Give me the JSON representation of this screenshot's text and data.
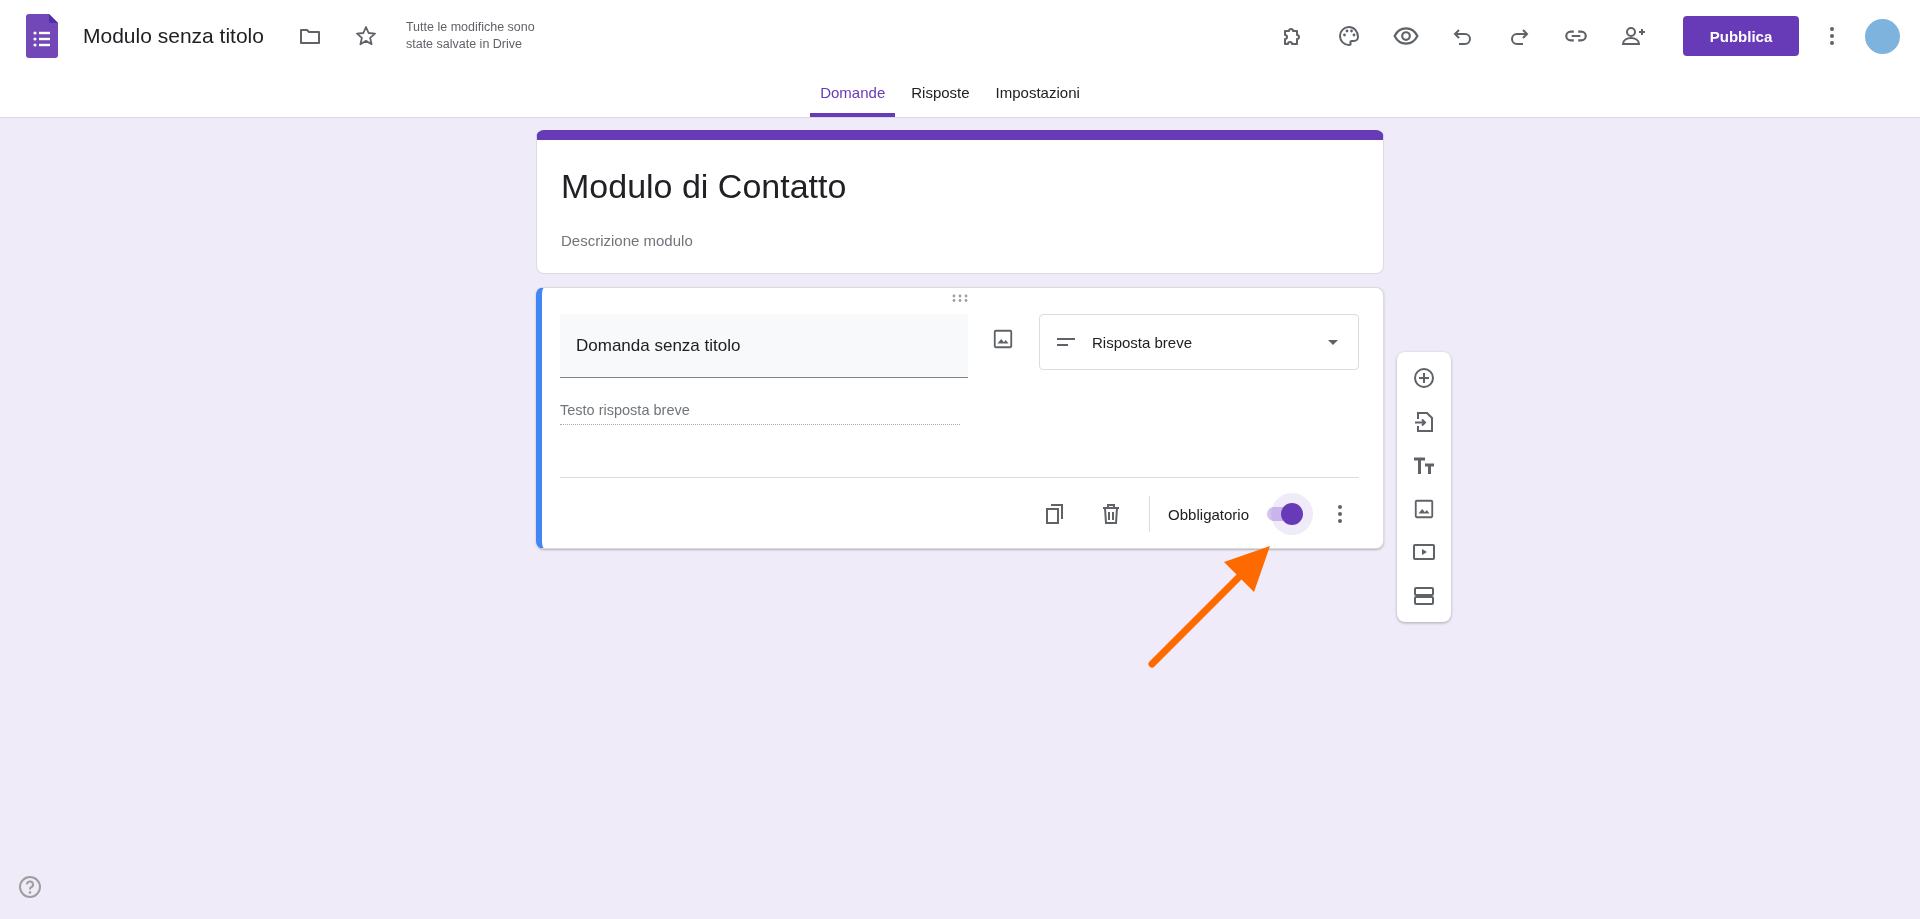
{
  "header": {
    "title": "Modulo senza titolo",
    "save_status": "Tutte le modifiche sono state salvate in Drive",
    "publish_button": "Pubblica"
  },
  "tabs": [
    {
      "label": "Domande",
      "selected": true
    },
    {
      "label": "Risposte",
      "selected": false
    },
    {
      "label": "Impostazioni",
      "selected": false
    }
  ],
  "form": {
    "title": "Modulo di Contatto",
    "description_placeholder": "Descrizione modulo"
  },
  "question": {
    "title": "Domanda senza titolo",
    "type": "Risposta breve",
    "answer_placeholder": "Testo risposta breve",
    "required_label": "Obbligatorio",
    "required": true
  }
}
